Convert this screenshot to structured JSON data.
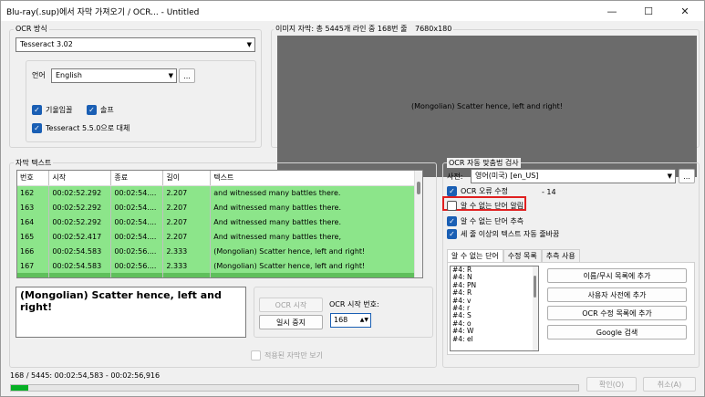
{
  "window": {
    "title": "Blu-ray(.sup)에서 자막 가져오기 / OCR... - Untitled",
    "minimize_icon": "minimize-icon",
    "maximize_icon": "maximize-icon",
    "close_icon": "close-icon"
  },
  "ocr_method": {
    "group_label": "OCR 방식",
    "engine_value": "Tesseract 3.02",
    "language_label": "언어",
    "language_value": "English",
    "language_more": "...",
    "italic_label": "기울임꼴",
    "italic_checked": true,
    "fix_label": "솔프",
    "fix_checked": true,
    "tesseract_label": "Tesseract 5.5.0으로 대체",
    "tesseract_checked": true
  },
  "image_preview": {
    "header": "이미지 자막: 총 5445개 라인 중 168번 줄",
    "resolution": "7680x180",
    "text": "(Mongolian) Scatter hence, left and right!"
  },
  "subtitles": {
    "group_label": "자막 텍스트",
    "columns": [
      "번호",
      "시작",
      "종료",
      "길이",
      "텍스트"
    ],
    "rows": [
      {
        "num": "162",
        "start": "00:02:52.292",
        "end": "00:02:54....",
        "dur": "2.207",
        "text": "and witnessed many battles there.",
        "selected": false
      },
      {
        "num": "163",
        "start": "00:02:52.292",
        "end": "00:02:54....",
        "dur": "2.207",
        "text": "And witnessed many battles there.",
        "selected": false
      },
      {
        "num": "164",
        "start": "00:02:52.292",
        "end": "00:02:54....",
        "dur": "2.207",
        "text": "And witnessed many battles there.",
        "selected": false
      },
      {
        "num": "165",
        "start": "00:02:52.417",
        "end": "00:02:54....",
        "dur": "2.207",
        "text": "And witnessed many battles there,",
        "selected": false
      },
      {
        "num": "166",
        "start": "00:02:54.583",
        "end": "00:02:56....",
        "dur": "2.333",
        "text": "(Mongolian) Scatter hence, left and right!",
        "selected": false
      },
      {
        "num": "167",
        "start": "00:02:54.583",
        "end": "00:02:56....",
        "dur": "2.333",
        "text": "(Mongolian) Scatter hence, left and right!",
        "selected": false
      },
      {
        "num": "168",
        "start": "00:02:54.583",
        "end": "00:02:56....",
        "dur": "2.333",
        "text": "(Mongolian) Scatter hence, left and right!",
        "selected": true
      }
    ],
    "current_text": "(Mongolian) Scatter hence, left and right!"
  },
  "ocr_controls": {
    "start_label": "OCR 시작",
    "pause_label": "일시 중지",
    "start_number_label": "OCR 시작 번호:",
    "start_number_value": "168",
    "show_applied_label": "적용된 자막만 보기"
  },
  "spellcheck": {
    "group_label": "OCR 자동 맞춤법 검사",
    "dictionary_label": "사전:",
    "dictionary_value": "영어(미국) [en_US]",
    "dictionary_more": "...",
    "fix_ocr_label": "OCR 오류 수정",
    "fix_ocr_checked": true,
    "fix_ocr_count": "- 14",
    "prompt_unknown_label": "알 수 없는 단어 알림",
    "prompt_unknown_checked": false,
    "guess_unknown_label": "알 수 없는 단어 추측",
    "guess_unknown_checked": true,
    "autobreak_label": "세 줄 이상의 텍스트 자동 줄바꿈",
    "autobreak_checked": true,
    "tabs": [
      "알 수 없는 단어",
      "수정 목록",
      "추측 사용"
    ],
    "unknown_words": [
      "#4: R",
      "#4: N",
      "#4: PN",
      "#4: R",
      "#4: v",
      "#4: r",
      "#4: S",
      "#4: o",
      "#4: W",
      "#4: el"
    ],
    "add_names_label": "이름/무시 목록에 추가",
    "add_user_dict_label": "사용자 사전에 추가",
    "add_ocr_fix_label": "OCR 수정 목록에 추가",
    "google_label": "Google 검색"
  },
  "footer": {
    "status": "168 / 5445: 00:02:54,583 - 00:02:56,916",
    "progress": 0.03,
    "ok_label": "확인(O)",
    "cancel_label": "취소(A)"
  }
}
